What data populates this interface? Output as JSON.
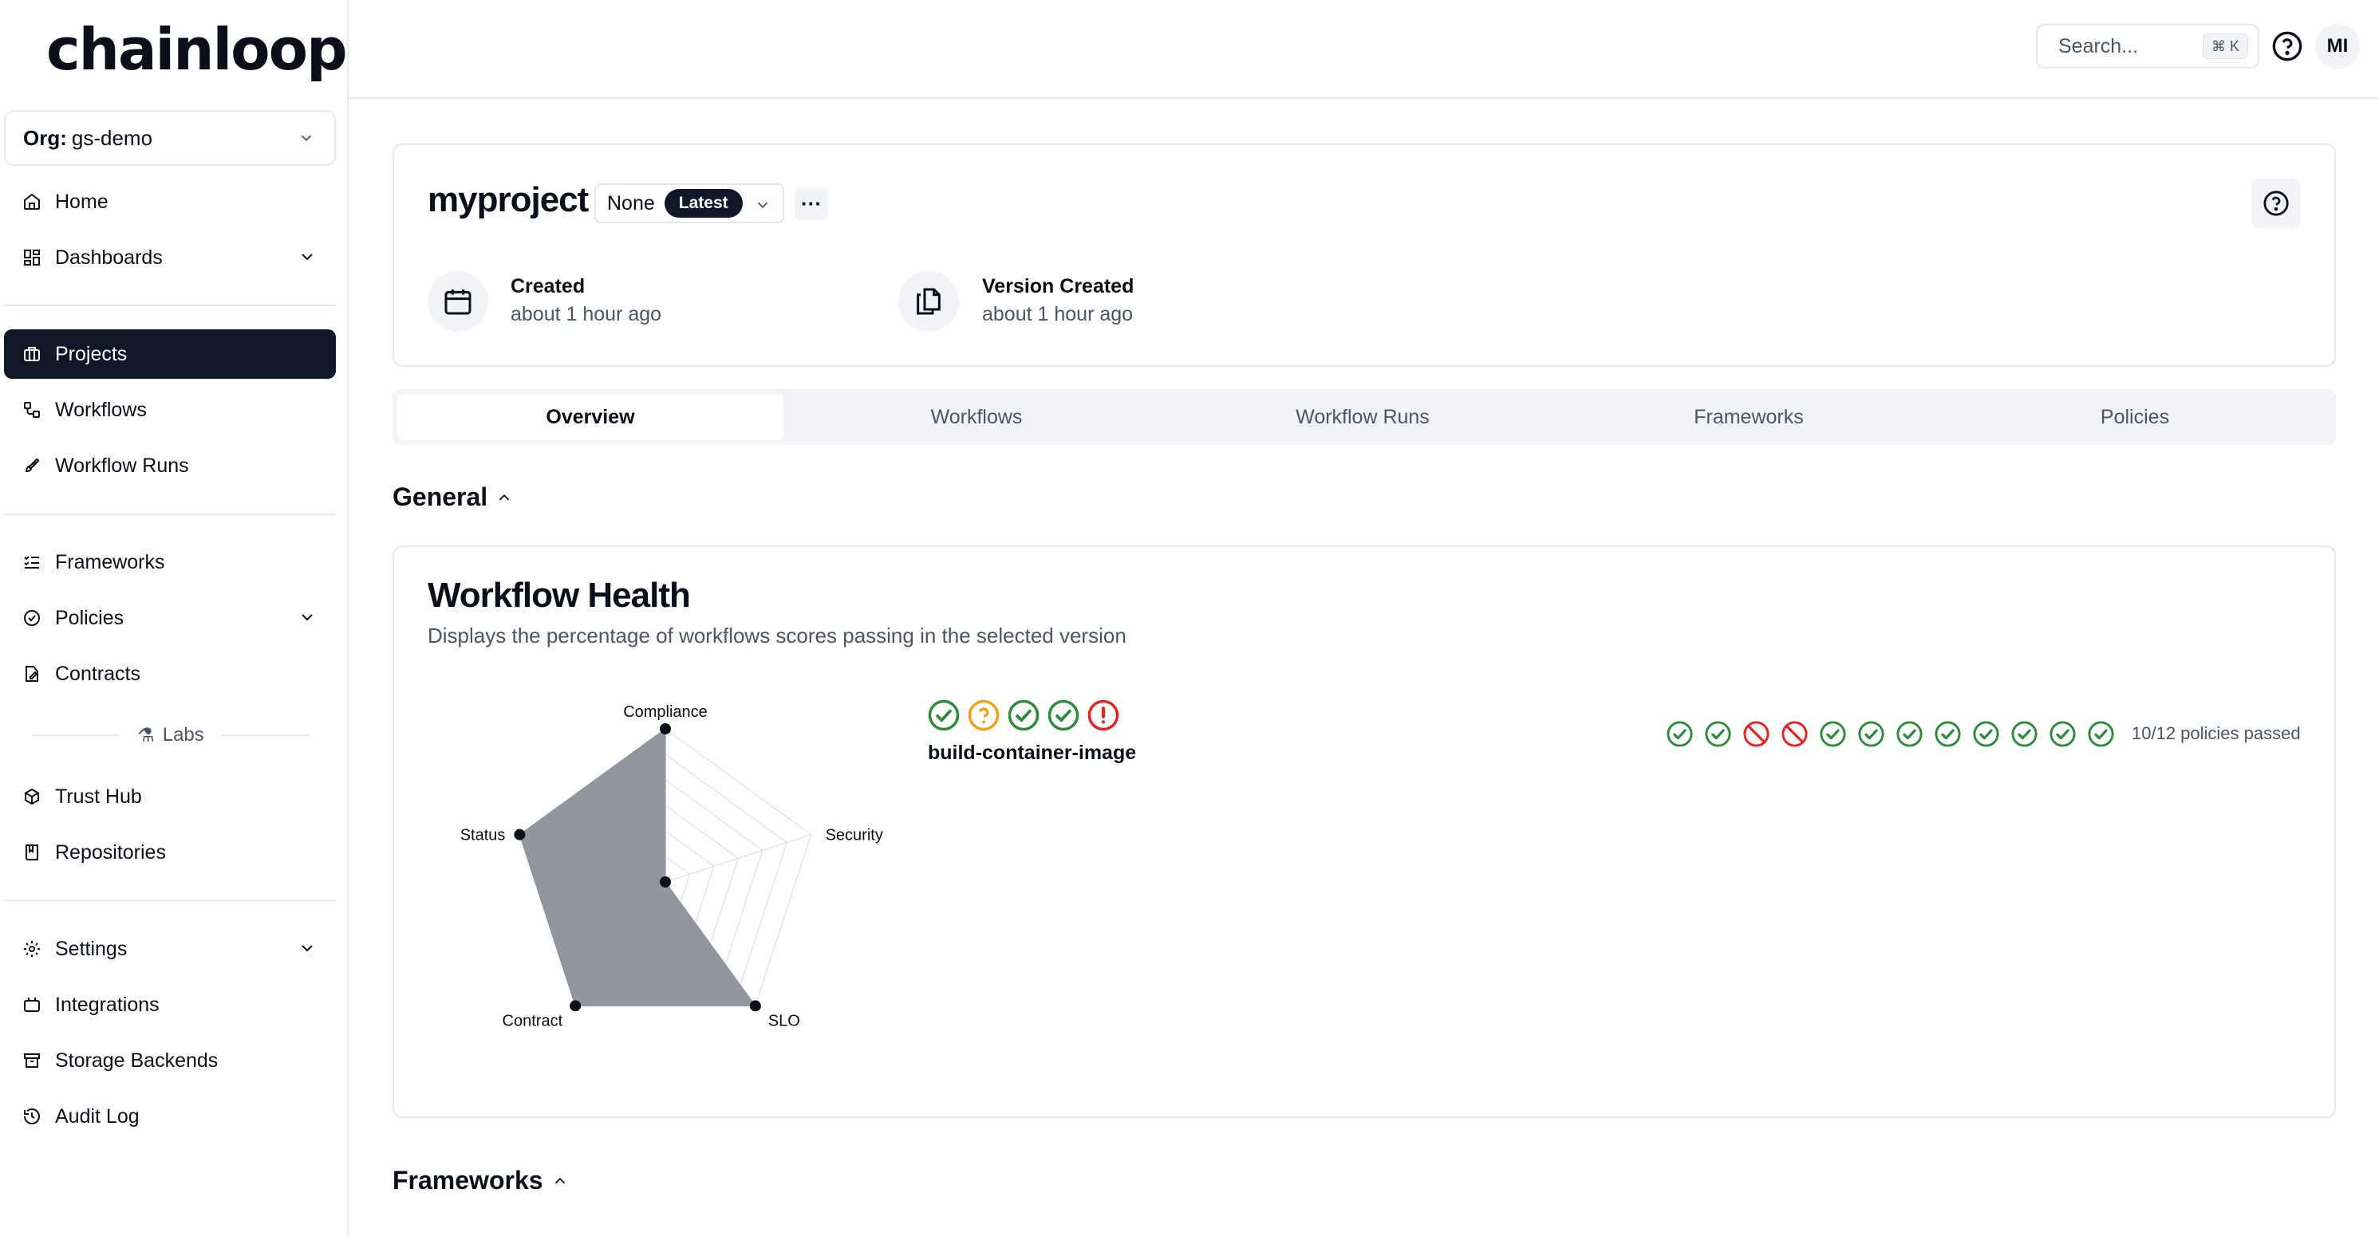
{
  "app": {
    "logo": "chainloop"
  },
  "org": {
    "label": "Org:",
    "value": "gs-demo"
  },
  "sidebar": {
    "items": [
      {
        "label": "Home",
        "icon": "home-icon"
      },
      {
        "label": "Dashboards",
        "icon": "dashboard-icon"
      },
      {
        "label": "Projects",
        "icon": "briefcase-icon",
        "active": true
      },
      {
        "label": "Workflows",
        "icon": "workflow-icon"
      },
      {
        "label": "Workflow Runs",
        "icon": "rocket-icon"
      },
      {
        "label": "Frameworks",
        "icon": "list-check-icon"
      },
      {
        "label": "Policies",
        "icon": "circle-check-icon"
      },
      {
        "label": "Contracts",
        "icon": "file-pen-icon"
      },
      {
        "label": "Trust Hub",
        "icon": "cube-icon"
      },
      {
        "label": "Repositories",
        "icon": "book-icon"
      },
      {
        "label": "Settings",
        "icon": "gear-icon"
      },
      {
        "label": "Integrations",
        "icon": "plug-icon"
      },
      {
        "label": "Storage Backends",
        "icon": "archive-icon"
      },
      {
        "label": "Audit Log",
        "icon": "history-icon"
      }
    ],
    "labs_label": "Labs"
  },
  "topbar": {
    "search_placeholder": "Search...",
    "search_shortcut": "⌘ K",
    "avatar_initials": "MI"
  },
  "project": {
    "name": "myproject",
    "version": "None",
    "version_badge": "Latest",
    "more": "···",
    "created_label": "Created",
    "created_value": "about 1 hour ago",
    "version_created_label": "Version Created",
    "version_created_value": "about 1 hour ago"
  },
  "tabs": [
    "Overview",
    "Workflows",
    "Workflow Runs",
    "Frameworks",
    "Policies"
  ],
  "sections": {
    "general": "General",
    "frameworks": "Frameworks"
  },
  "workflow_health": {
    "title": "Workflow Health",
    "description": "Displays the percentage of workflows scores passing in the selected version",
    "workflow_name": "build-container-image",
    "workflow_statuses": [
      "pass",
      "warning",
      "pass",
      "pass",
      "error"
    ],
    "policies": [
      "pass",
      "pass",
      "blocked",
      "blocked",
      "pass",
      "pass",
      "pass",
      "pass",
      "pass",
      "pass",
      "pass",
      "pass"
    ],
    "policies_summary": "10/12 policies passed"
  },
  "chart_data": {
    "type": "radar",
    "axes": [
      "Compliance",
      "Security",
      "SLO",
      "Contract",
      "Status"
    ],
    "values": [
      100,
      0,
      100,
      100,
      100
    ],
    "range": [
      0,
      100
    ],
    "fill_color": "#8d9099",
    "grid": true
  },
  "colors": {
    "pass": "#2e8b3e",
    "warning": "#f0a020",
    "error": "#e02424",
    "primary": "#0f1729"
  }
}
